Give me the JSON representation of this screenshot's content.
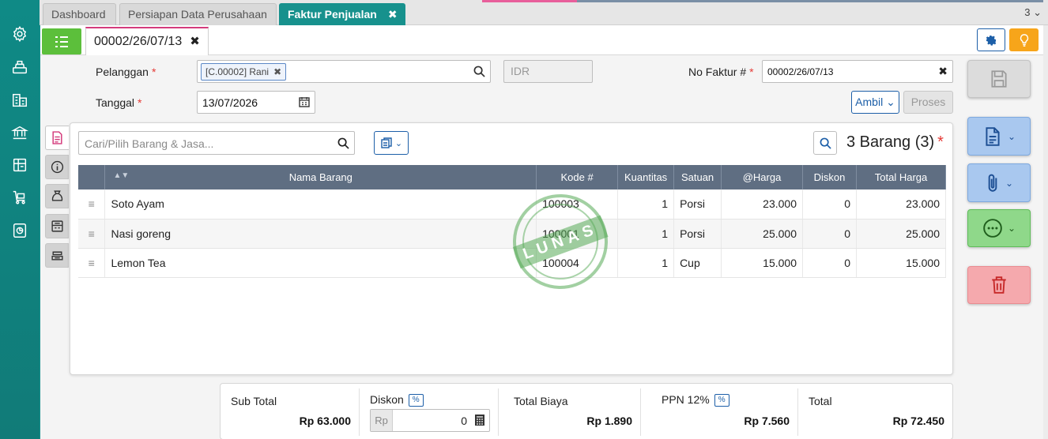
{
  "top_tabs": [
    {
      "label": "Dashboard"
    },
    {
      "label": "Persiapan Data Perusahaan"
    },
    {
      "label": "Faktur Penjualan"
    }
  ],
  "top_counter": "3",
  "doc_tab": {
    "label": "00002/26/07/13"
  },
  "form": {
    "customer_label": "Pelanggan",
    "customer_value": "[C.00002] Rani",
    "currency": "IDR",
    "date_label": "Tanggal",
    "date_value": "13/07/2026",
    "invoice_label": "No Faktur #",
    "invoice_value": "00002/26/07/13",
    "ambil_label": "Ambil",
    "proses_label": "Proses",
    "required_mark": "*"
  },
  "items": {
    "search_placeholder": "Cari/Pilih Barang & Jasa...",
    "count_label": "3 Barang (3)",
    "columns": [
      "Nama Barang",
      "Kode #",
      "Kuantitas",
      "Satuan",
      "@Harga",
      "Diskon",
      "Total Harga"
    ],
    "rows": [
      {
        "name": "Soto Ayam",
        "code": "100003",
        "qty": "1",
        "unit": "Porsi",
        "price": "23.000",
        "discount": "0",
        "total": "23.000"
      },
      {
        "name": "Nasi goreng",
        "code": "100001",
        "qty": "1",
        "unit": "Porsi",
        "price": "25.000",
        "discount": "0",
        "total": "25.000"
      },
      {
        "name": "Lemon Tea",
        "code": "100004",
        "qty": "1",
        "unit": "Cup",
        "price": "15.000",
        "discount": "0",
        "total": "15.000"
      }
    ],
    "stamp": "LUNAS"
  },
  "totals": {
    "subtotal_label": "Sub Total",
    "subtotal_value": "Rp 63.000",
    "discount_label": "Diskon",
    "discount_currency": "Rp",
    "discount_value": "0",
    "pct_badge": "%",
    "cost_label": "Total Biaya",
    "cost_value": "Rp 1.890",
    "tax_label": "PPN 12%",
    "tax_value": "Rp 7.560",
    "total_label": "Total",
    "total_value": "Rp 72.450"
  },
  "colors": {
    "sidebar": "#117b78",
    "active_tab": "#17918d",
    "primary": "#1d5fa8",
    "save": "#d6d6d6",
    "document": "#a9c8ef",
    "attach": "#a9c8ef",
    "more": "#8fd88a",
    "delete": "#f5a9ad"
  }
}
